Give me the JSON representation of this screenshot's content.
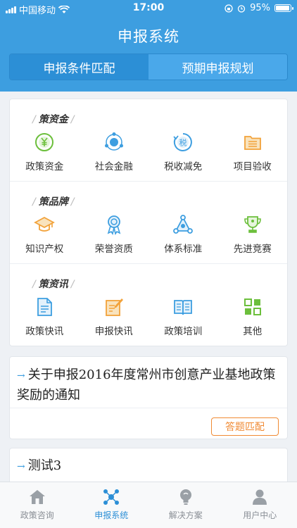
{
  "status_bar": {
    "carrier": "中国移动",
    "time": "17:00",
    "battery": "95%",
    "battery_level": 0.95
  },
  "header": {
    "title": "申报系统"
  },
  "segment": {
    "tabs": [
      {
        "label": "申报条件匹配",
        "active": true
      },
      {
        "label": "预期申报规划",
        "active": false
      }
    ]
  },
  "sections": [
    {
      "title": "策资金",
      "items": [
        {
          "label": "政策资金",
          "icon": "yen-coin-icon"
        },
        {
          "label": "社会金融",
          "icon": "network-icon"
        },
        {
          "label": "税收减免",
          "icon": "tax-icon"
        },
        {
          "label": "项目验收",
          "icon": "folder-list-icon"
        }
      ]
    },
    {
      "title": "策品牌",
      "items": [
        {
          "label": "知识产权",
          "icon": "graduation-cap-icon"
        },
        {
          "label": "荣誉资质",
          "icon": "award-ribbon-icon"
        },
        {
          "label": "体系标准",
          "icon": "triangle-nodes-icon"
        },
        {
          "label": "先进竞赛",
          "icon": "trophy-icon"
        }
      ]
    },
    {
      "title": "策资讯",
      "items": [
        {
          "label": "政策快讯",
          "icon": "document-icon"
        },
        {
          "label": "申报快讯",
          "icon": "edit-note-icon"
        },
        {
          "label": "政策培训",
          "icon": "open-book-icon"
        },
        {
          "label": "其他",
          "icon": "grid-apps-icon"
        }
      ]
    }
  ],
  "news": [
    {
      "title": "关于申报2016年度常州市创意产业基地政策奖励的通知",
      "button": "答题匹配"
    },
    {
      "title": "测试3"
    }
  ],
  "tabbar": [
    {
      "label": "政策咨询",
      "icon": "home-icon",
      "active": false
    },
    {
      "label": "申报系统",
      "icon": "hub-icon",
      "active": true
    },
    {
      "label": "解决方案",
      "icon": "lightbulb-icon",
      "active": false
    },
    {
      "label": "用户中心",
      "icon": "user-icon",
      "active": false
    }
  ],
  "colors": {
    "primary": "#3d9ee0",
    "accent_orange": "#f08a33",
    "icon_green": "#6cbf3c",
    "icon_blue": "#3d9ee0",
    "icon_orange": "#f2a23a"
  }
}
